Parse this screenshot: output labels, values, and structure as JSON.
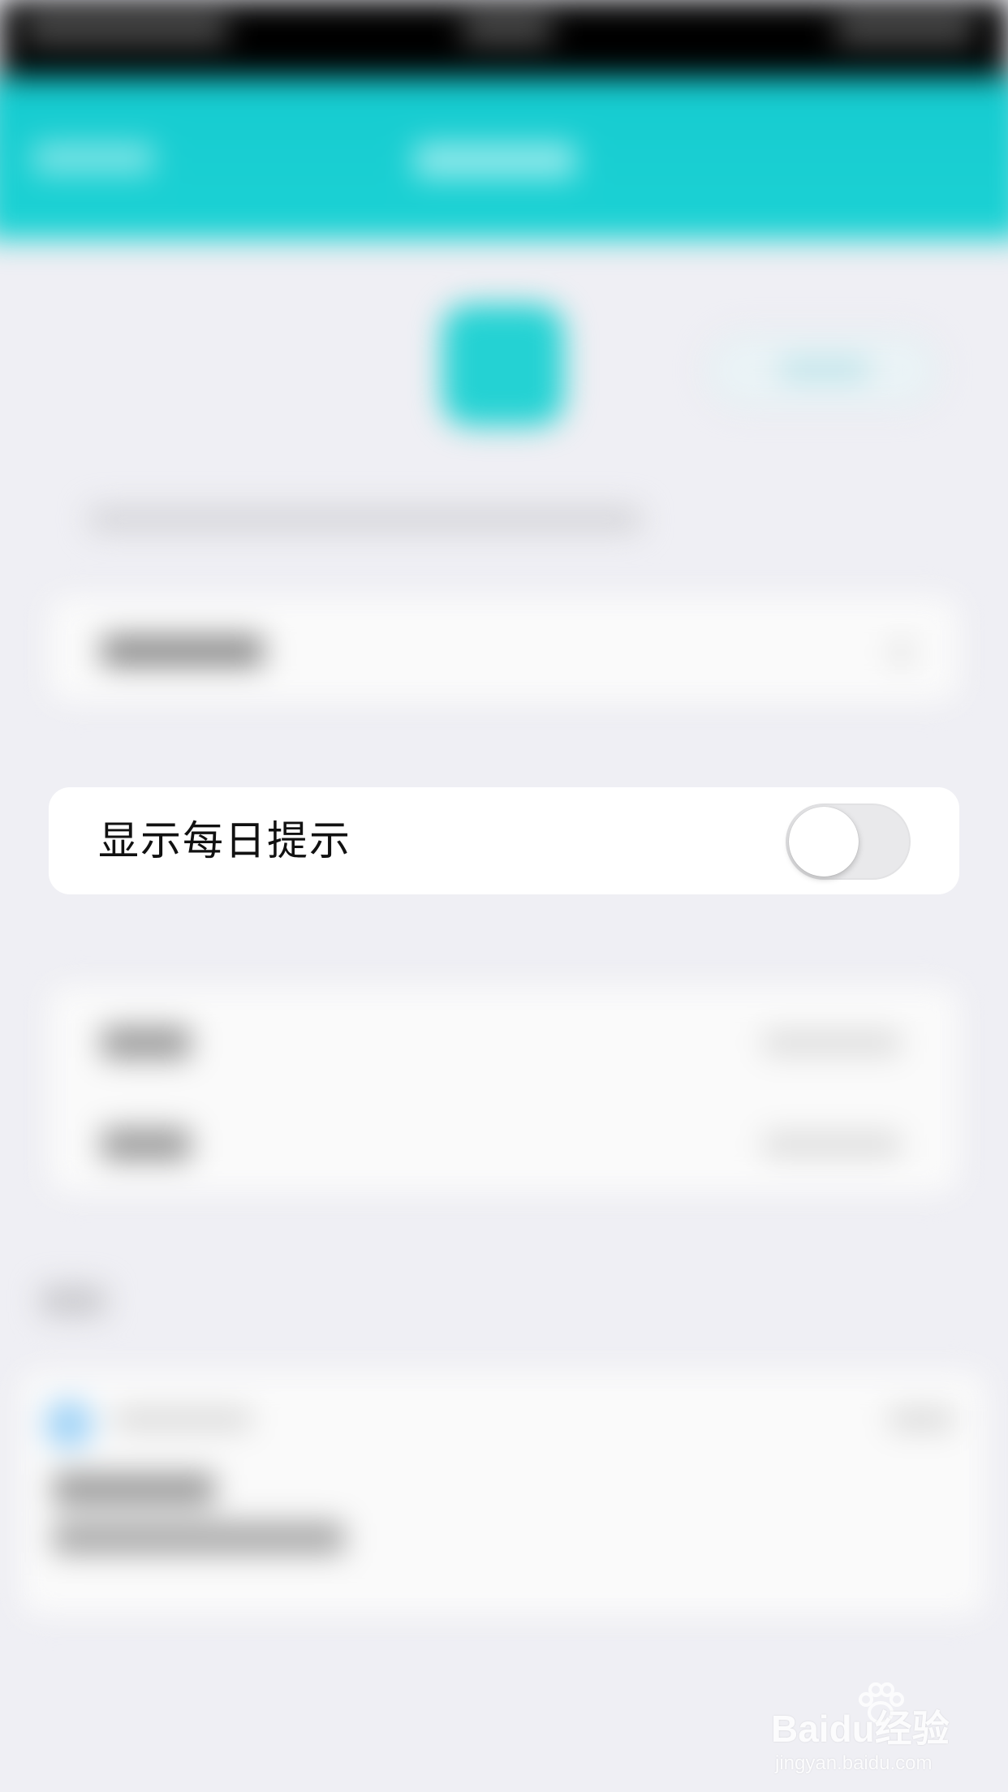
{
  "settings": {
    "daily_tip_label": "显示每日提示",
    "daily_tip_enabled": false
  },
  "colors": {
    "nav_bar": "#1ccfd2",
    "background": "#efeff4",
    "toggle_off_track": "#e9e9eb",
    "toggle_knob": "#ffffff"
  },
  "watermark": {
    "logo_text": "Baidu经验",
    "url": "jingyan.baidu.com"
  }
}
